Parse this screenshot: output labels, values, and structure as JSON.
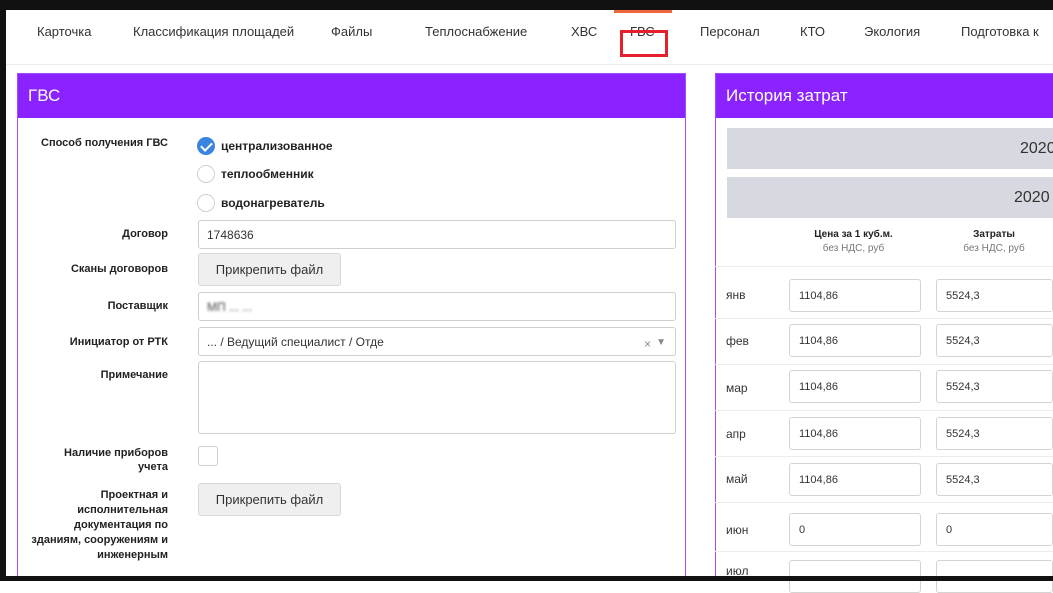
{
  "tabs": [
    {
      "label": "Карточка"
    },
    {
      "label": "Классификация площадей"
    },
    {
      "label": "Файлы"
    },
    {
      "label": "Теплоснабжение"
    },
    {
      "label": "ХВС"
    },
    {
      "label": "ГВС"
    },
    {
      "label": "Персонал"
    },
    {
      "label": "КТО"
    },
    {
      "label": "Экология"
    },
    {
      "label": "Подготовка к"
    }
  ],
  "colors": {
    "accent": "#8a23ff",
    "active_tab": "#f0663b",
    "highlight": "#e4202d",
    "radio_checked": "#3a84e0"
  },
  "gvs": {
    "title": "ГВС",
    "method_label": "Способ получения ГВС",
    "options": [
      {
        "label": "централизованное",
        "checked": true
      },
      {
        "label": "теплообменник",
        "checked": false
      },
      {
        "label": "водонагреватель",
        "checked": false
      }
    ],
    "contract_label": "Договор",
    "contract_value": "1748636",
    "scans_label": "Сканы договоров",
    "attach_label": "Прикрепить файл",
    "supplier_label": "Поставщик",
    "supplier_value": "МП ... ...",
    "initiator_label": "Инициатор от РТК",
    "initiator_value": "... / Ведущий специалист / Отде",
    "note_label": "Примечание",
    "note_value": "",
    "meters_label_1": "Наличие приборов",
    "meters_label_2": "учета",
    "meters_checked": false,
    "docs_label_lines": [
      "Проектная и",
      "исполнительная",
      "документация по",
      "зданиям, сооружениям и",
      "инженерным"
    ],
    "docs_attach_label": "Прикрепить файл"
  },
  "history": {
    "title": "История затрат",
    "year_1": "2020",
    "year_2": "2020",
    "col_price_title": "Цена за 1 куб.м.",
    "col_price_sub": "без НДС, руб",
    "col_cost_title": "Затраты",
    "col_cost_sub": "без НДС, руб",
    "rows": [
      {
        "month": "янв",
        "price": "1104,86",
        "cost": "5524,3"
      },
      {
        "month": "фев",
        "price": "1104,86",
        "cost": "5524,3"
      },
      {
        "month": "мар",
        "price": "1104,86",
        "cost": "5524,3"
      },
      {
        "month": "апр",
        "price": "1104,86",
        "cost": "5524,3"
      },
      {
        "month": "май",
        "price": "1104,86",
        "cost": "5524,3"
      },
      {
        "month": "июн",
        "price": "0",
        "cost": "0"
      },
      {
        "month": "июл",
        "price": "",
        "cost": ""
      }
    ]
  }
}
